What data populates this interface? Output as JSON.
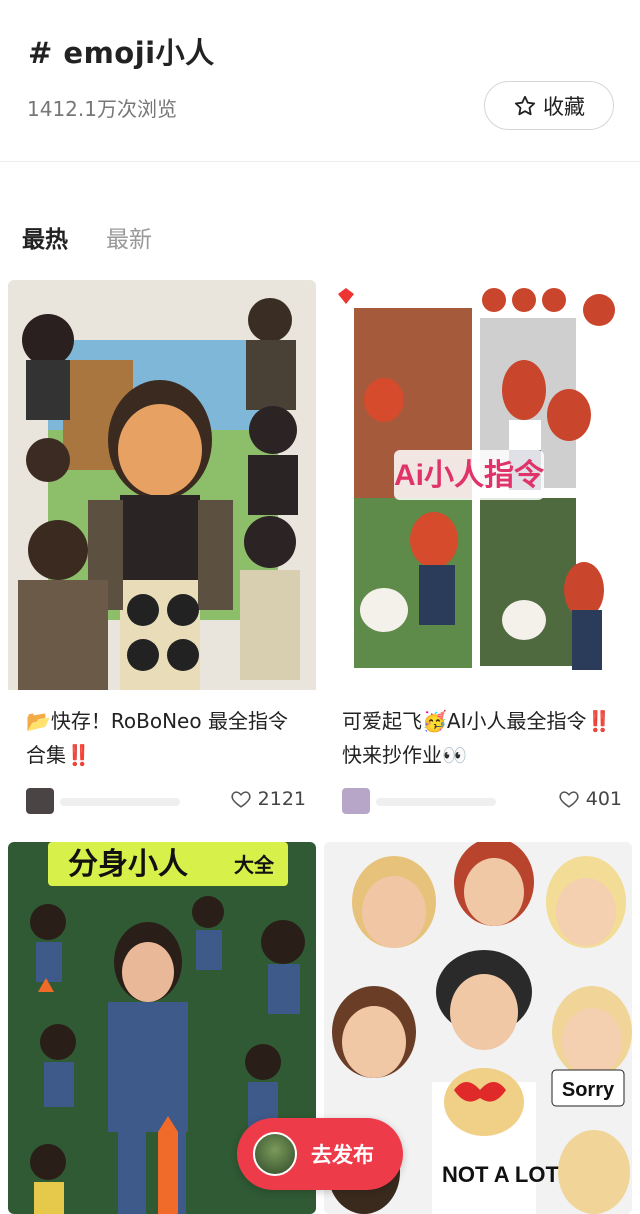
{
  "topic": {
    "title": "# emoji小人",
    "views": "1412.1万次浏览",
    "favorite_label": "收藏",
    "favorite_icon": "star-outline-icon"
  },
  "tabs": [
    {
      "label": "最热",
      "active": true
    },
    {
      "label": "最新",
      "active": false
    }
  ],
  "posts": [
    {
      "title": "📂快存！RoBoNeo 最全指令合集‼️",
      "likes": "2121"
    },
    {
      "title": "可爱起飞🥳AI小人最全指令‼️快来抄作业👀",
      "likes": "401"
    },
    {
      "cover_text": "分身小人",
      "cover_sub": "大全"
    },
    {
      "cover_text": "NOT A LOT",
      "cover_sub": "Sorry"
    }
  ],
  "post2_cover_text": "Ai小人指令",
  "publish": {
    "label": "去发布"
  },
  "colors": {
    "accent": "#ee3b4a",
    "tab_inactive": "#999999"
  }
}
